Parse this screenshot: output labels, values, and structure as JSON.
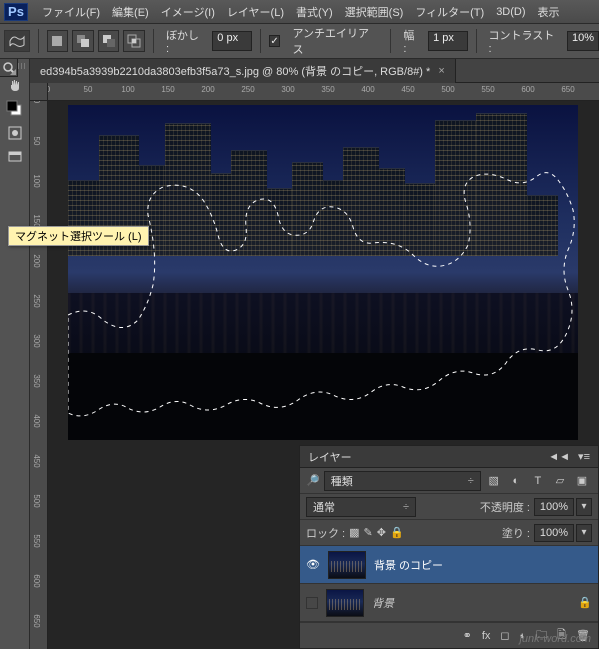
{
  "app": {
    "logo": "Ps"
  },
  "menu": [
    "ファイル(F)",
    "編集(E)",
    "イメージ(I)",
    "レイヤー(L)",
    "書式(Y)",
    "選択範囲(S)",
    "フィルター(T)",
    "3D(D)",
    "表示"
  ],
  "options": {
    "blur_label": "ぼかし :",
    "blur_value": "0 px",
    "antialias_label": "アンチエイリアス",
    "width_label": "幅 :",
    "width_value": "1 px",
    "contrast_label": "コントラスト :",
    "contrast_value": "10%"
  },
  "document": {
    "tab_title": "ed394b5a3939b2210da3803efb3f5a73_s.jpg @ 80% (背景 のコピー, RGB/8#) *",
    "close": "×"
  },
  "tooltip": "マグネット選択ツール (L)",
  "ruler_h": [
    "0",
    "50",
    "100",
    "150",
    "200",
    "250",
    "300",
    "350",
    "400",
    "450",
    "500",
    "550",
    "600",
    "650"
  ],
  "ruler_v": [
    "0",
    "50",
    "100",
    "150",
    "200",
    "250",
    "300",
    "350",
    "400",
    "450",
    "500",
    "550",
    "600",
    "650"
  ],
  "layers_panel": {
    "title": "レイヤー",
    "kind_filter": "種類",
    "blend_mode": "通常",
    "opacity_label": "不透明度 :",
    "opacity_value": "100%",
    "lock_label": "ロック :",
    "fill_label": "塗り :",
    "fill_value": "100%",
    "layers": [
      {
        "name": "背景 のコピー",
        "visible": true,
        "locked": false,
        "selected": true
      },
      {
        "name": "背景",
        "visible": false,
        "locked": true,
        "selected": false
      }
    ]
  },
  "tools": [
    "move-tool",
    "rect-marquee-tool",
    "magnetic-lasso-tool",
    "magic-wand-tool",
    "crop-tool",
    "eyedropper-tool",
    "healing-brush-tool",
    "brush-tool",
    "clone-stamp-tool",
    "history-brush-tool",
    "eraser-tool",
    "gradient-tool",
    "blur-tool",
    "dodge-tool",
    "pen-tool",
    "type-tool",
    "path-select-tool",
    "rectangle-tool",
    "hand-tool",
    "zoom-tool",
    "foreground-background-swatch",
    "quickmask-toggle",
    "screenmode-toggle"
  ],
  "watermark": "junk-word.com"
}
